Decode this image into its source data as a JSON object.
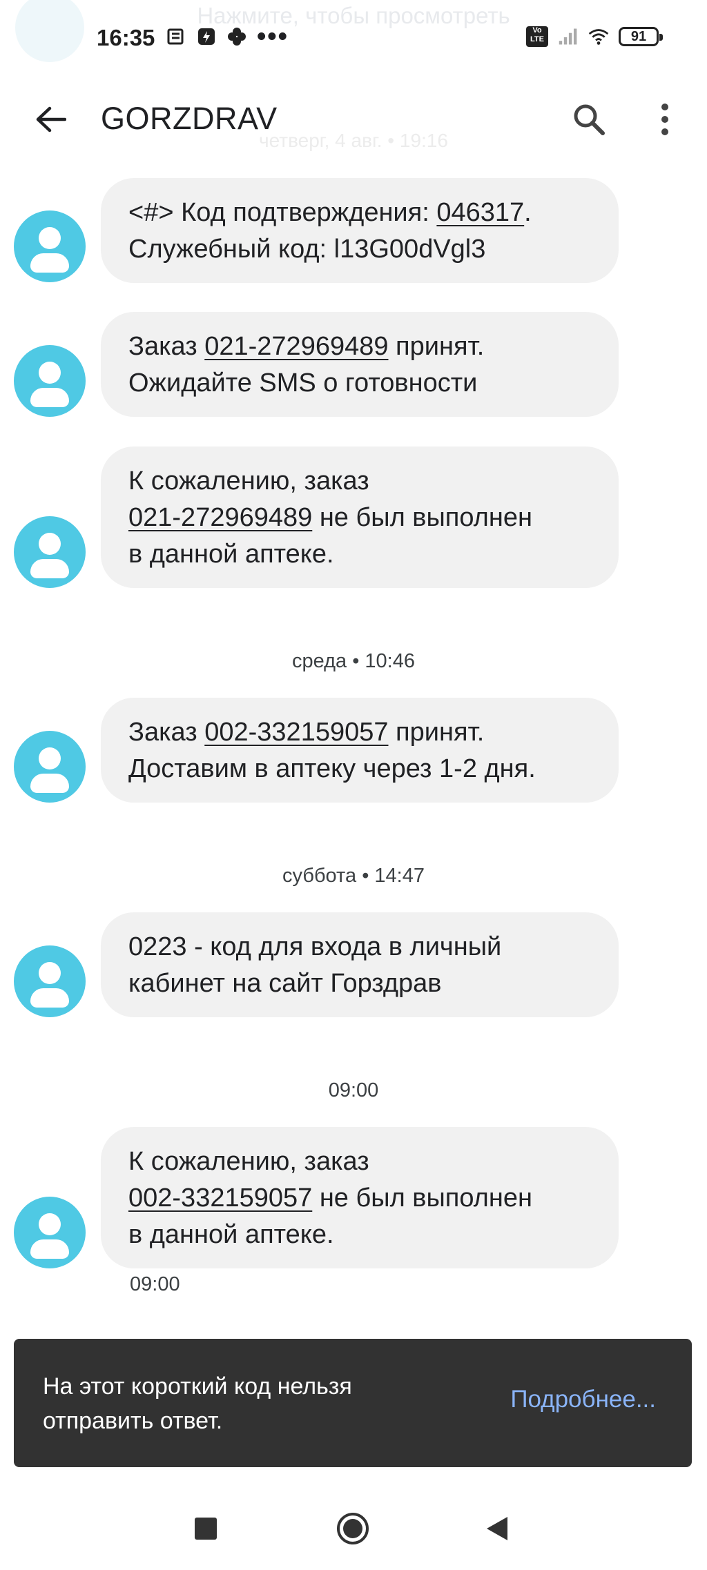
{
  "status_bar": {
    "notification_hint": "Нажмите, чтобы просмотреть",
    "time": "16:35",
    "more_indicator": "•••",
    "volte_label": "Vo LTE",
    "battery_level": "91",
    "icons": [
      "news-icon",
      "app-icon",
      "clover-icon",
      "signal-icon",
      "wifi-icon",
      "battery-icon"
    ]
  },
  "app_bar": {
    "title": "GORZDRAV",
    "faded_date": "четверг, 4 авг. • 19:16"
  },
  "messages": [
    {
      "pre": "<#> Код подтверждения: ",
      "link": "046317",
      "post": ".",
      "line2": "Служебный код: l13G00dVgl3"
    },
    {
      "pre": "Заказ ",
      "link": "021-272969489",
      "post": " принят.",
      "line2": "Ожидайте SMS о готовности"
    },
    {
      "line1": "К сожалению, заказ",
      "link": "021-272969489",
      "post": " не был выполнен",
      "line3": "в данной аптеке."
    },
    {
      "pre": "Заказ ",
      "link": "002-332159057",
      "post": " принят.",
      "line2": "Доставим в аптеку через 1-2 дня."
    },
    {
      "line1": "0223 - код для входа в личный",
      "line2": "кабинет на сайт Горздрав"
    },
    {
      "line1": "К сожалению, заказ",
      "link": "002-332159057",
      "post": " не был выполнен",
      "line3": "в данной аптеке."
    }
  ],
  "day_separators": [
    "среда • 10:46",
    "суббота • 14:47",
    "09:00"
  ],
  "last_message_time": "09:00",
  "snackbar": {
    "line1": "На этот короткий код нельзя",
    "line2": "отправить ответ.",
    "action": "Подробнее..."
  },
  "colors": {
    "avatar": "#4fc9e4",
    "bubble": "#f1f1f1",
    "snackbar": "#323232",
    "snackbar_action": "#8ab4f8"
  }
}
